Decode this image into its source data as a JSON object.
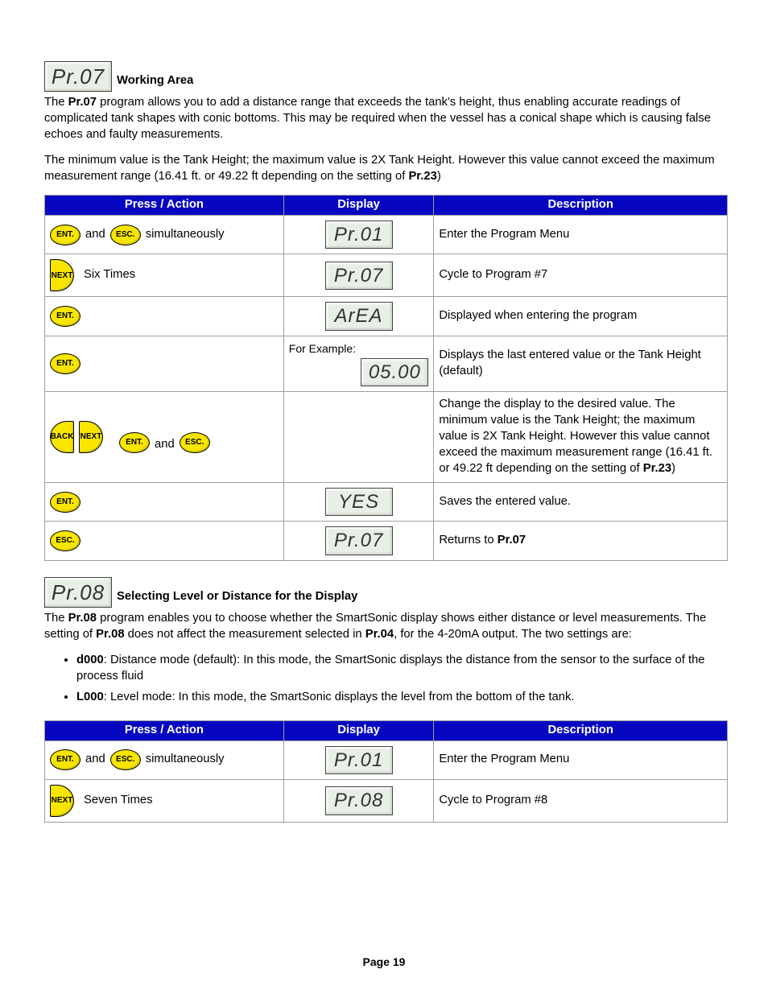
{
  "buttons": {
    "ent": "ENT.",
    "esc": "ESC.",
    "next": "NEXT",
    "back": "BACK"
  },
  "words": {
    "and": "and",
    "simultaneously": "simultaneously",
    "for_example": "For Example:"
  },
  "pr07": {
    "code": "Pr.07",
    "title": "Working Area",
    "p1_pre": "The ",
    "p1_b": "Pr.07",
    "p1_post": " program allows you to add a distance range that exceeds the tank's height, thus enabling accurate readings of complicated tank shapes with conic bottoms.  This may be required when the vessel has a conical shape which is causing false echoes and faulty measurements.",
    "p2_pre": "The minimum value is the Tank Height; the maximum value is 2X Tank Height.  However this value cannot exceed the maximum measurement range (16.41 ft. or 49.22 ft depending on the setting of ",
    "p2_b": "Pr.23",
    "p2_post": ")",
    "headers": {
      "c1": "Press / Action",
      "c2": "Display",
      "c3": "Description"
    },
    "rows": [
      {
        "action_type": "ent_esc",
        "disp": "Pr.01",
        "desc": "Enter the Program Menu"
      },
      {
        "action_type": "next_n",
        "suffix": "Six Times",
        "disp": "Pr.07",
        "desc": "Cycle to Program #7"
      },
      {
        "action_type": "ent",
        "disp": "ArEA",
        "desc": "Displayed when entering the program"
      },
      {
        "action_type": "ent",
        "disp": "05.00",
        "prefix": "for_example",
        "desc": "Displays the last entered value or the Tank Height (default)"
      },
      {
        "action_type": "back_next_and_ent_esc",
        "disp": "",
        "desc_pre": "Change the display to the desired value.  The minimum value is the Tank Height; the maximum value is 2X Tank Height.  However this value cannot exceed the maximum measurement range (16.41 ft. or 49.22 ft depending on the setting of ",
        "desc_b": "Pr.23",
        "desc_post": ")"
      },
      {
        "action_type": "ent",
        "disp": "YES",
        "desc": "Saves the entered value."
      },
      {
        "action_type": "esc",
        "disp": "Pr.07",
        "desc_pre": "Returns to ",
        "desc_b": "Pr.07"
      }
    ]
  },
  "pr08": {
    "code": "Pr.08",
    "title": "Selecting Level or Distance for the Display",
    "p1_pre": "The ",
    "p1_b1": "Pr.08",
    "p1_mid": " program enables you to choose whether the SmartSonic display shows either distance or level measurements.  The setting of ",
    "p1_b2": "Pr.08",
    "p1_mid2": " does not affect the measurement selected in ",
    "p1_b3": "Pr.04",
    "p1_post": ", for the 4-20mA output.  The two settings are:",
    "bul1_b": "d000",
    "bul1": ": Distance mode (default):  In this mode, the SmartSonic displays the distance from the sensor to the surface of the process fluid",
    "bul2_b": "L000",
    "bul2": ": Level mode:  In this mode, the SmartSonic displays the level from the bottom of the tank.",
    "headers": {
      "c1": "Press / Action",
      "c2": "Display",
      "c3": "Description"
    },
    "rows": [
      {
        "action_type": "ent_esc",
        "disp": "Pr.01",
        "desc": "Enter the Program Menu"
      },
      {
        "action_type": "next_n",
        "suffix": "Seven Times",
        "disp": "Pr.08",
        "desc": "Cycle to Program #8"
      }
    ]
  },
  "footer": "Page 19"
}
